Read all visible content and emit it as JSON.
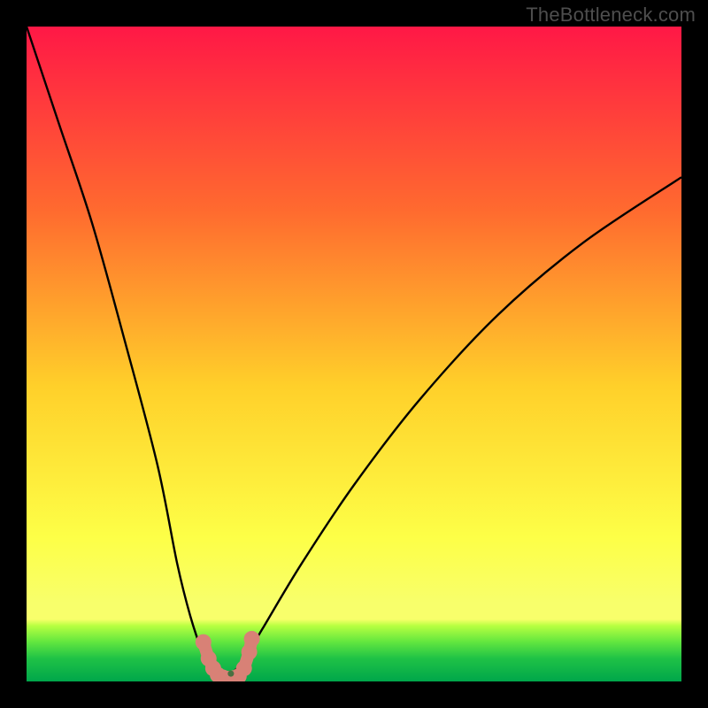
{
  "watermark": "TheBottleneck.com",
  "colors": {
    "background": "#000000",
    "grad_start": "#ff1846",
    "grad_mid1": "#ff6a2f",
    "grad_mid2": "#ffd02a",
    "grad_mid3": "#fdff47",
    "grad_band_yellow": "#f8ff6b",
    "grad_band_lg": "#b7ff40",
    "grad_band_g1": "#61e63f",
    "grad_band_g2": "#1fc246",
    "grad_bottom": "#00a64a",
    "curve": "#000000",
    "marker": "#d88176",
    "dot_dark": "#4a6f41"
  },
  "chart_data": {
    "type": "line",
    "title": "",
    "xlabel": "",
    "ylabel": "",
    "xlim": [
      0,
      100
    ],
    "ylim": [
      0,
      100
    ],
    "series": [
      {
        "name": "bottleneck-curve",
        "x": [
          0,
          5,
          10,
          15,
          20,
          23,
          25,
          27,
          28,
          29,
          29.5,
          30,
          30.5,
          31,
          33,
          36,
          42,
          50,
          60,
          72,
          85,
          100
        ],
        "y": [
          100,
          85,
          70,
          52,
          33,
          18,
          10,
          4,
          2,
          1,
          0.5,
          0.3,
          0.5,
          1,
          3,
          8,
          18,
          30,
          43,
          56,
          67,
          77
        ]
      }
    ],
    "markers": [
      {
        "name": "left-cluster-top",
        "x": 27.0,
        "y": 6.0
      },
      {
        "name": "left-cluster-a",
        "x": 27.8,
        "y": 3.5
      },
      {
        "name": "left-cluster-b",
        "x": 28.5,
        "y": 2.0
      },
      {
        "name": "left-cluster-c",
        "x": 29.2,
        "y": 1.0
      },
      {
        "name": "left-cluster-d",
        "x": 30.0,
        "y": 0.6
      },
      {
        "name": "bottom-a",
        "x": 30.8,
        "y": 0.4
      },
      {
        "name": "bottom-b",
        "x": 31.6,
        "y": 0.5
      },
      {
        "name": "bottom-c",
        "x": 32.4,
        "y": 0.8
      },
      {
        "name": "right-cluster-a",
        "x": 33.2,
        "y": 2.0
      },
      {
        "name": "right-cluster-b",
        "x": 34.0,
        "y": 4.5
      },
      {
        "name": "right-cluster-top",
        "x": 34.4,
        "y": 6.5
      }
    ],
    "center_dot": {
      "x": 31.2,
      "y": 1.2
    }
  }
}
